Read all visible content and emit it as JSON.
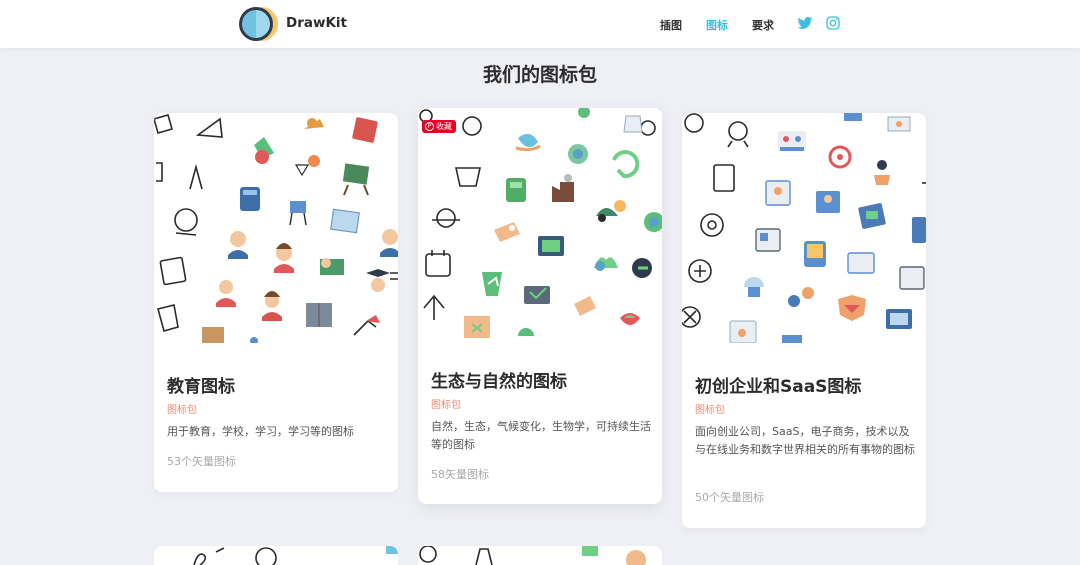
{
  "navbar": {
    "brand": "DrawKit",
    "links": [
      {
        "label": "插图",
        "active": false
      },
      {
        "label": "图标",
        "active": true
      },
      {
        "label": "要求",
        "active": false
      }
    ],
    "social": [
      "twitter-icon",
      "instagram-icon"
    ],
    "accent_color": "#3ebde2"
  },
  "page": {
    "title": "我们的图标包"
  },
  "cards": [
    {
      "title": "教育图标",
      "tag": "图标包",
      "description": "用于教育，学校，学习，学习等的图标",
      "count": "53个矢量图标"
    },
    {
      "title": "生态与自然的图标",
      "tag": "图标包",
      "description": "自然，生态，气候变化，生物学，可持续生活等的图标",
      "count": "58矢量图标",
      "save_badge": "收藏"
    },
    {
      "title": "初创企业和SaaS图标",
      "tag": "图标包",
      "description": "面向创业公司，SaaS，电子商务，技术以及与在线业务和数字世界相关的所有事物的图标",
      "count": "50个矢量图标"
    }
  ],
  "colors": {
    "tag": "#f08a6b",
    "background": "#eff0f6",
    "save_badge": "#e60023"
  }
}
